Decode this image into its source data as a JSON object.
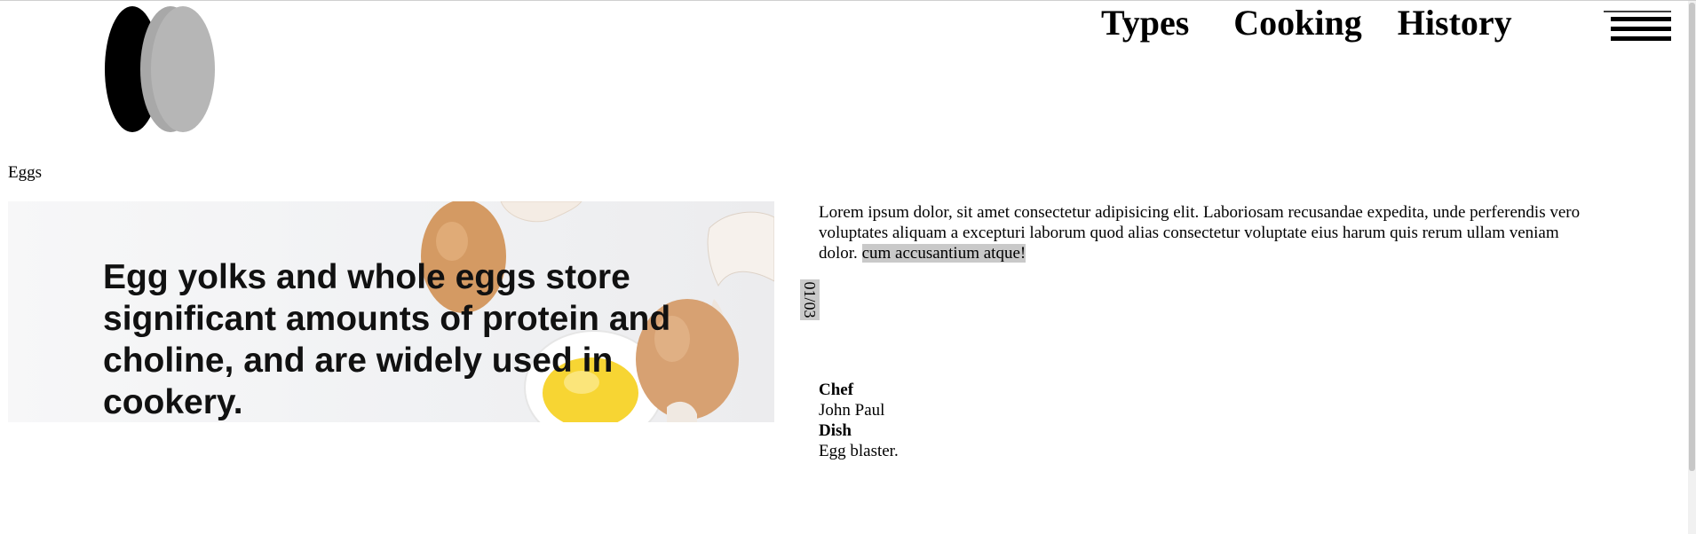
{
  "header": {
    "logo_icon": "egg-pair-logo",
    "nav": [
      {
        "label": "Types"
      },
      {
        "label": "Cooking"
      },
      {
        "label": "History"
      }
    ],
    "menu_icon": "hamburger-menu-icon"
  },
  "breadcrumb": "Eggs",
  "hero": {
    "caption": "Egg yolks and whole eggs store significant amounts of protein and choline, and are widely used in cookery."
  },
  "article": {
    "body": "Lorem ipsum dolor, sit amet consectetur adipisicing elit. Laboriosam recusandae expedita, unde perferendis vero voluptates aliquam a excepturi laborum quod alias consectetur voluptate eius harum quis rerum ullam veniam dolor. ",
    "highlighted": "cum accusantium atque!"
  },
  "slider": {
    "counter": "01/03"
  },
  "meta": {
    "chef_label": "Chef",
    "chef_value": "John Paul",
    "dish_label": "Dish",
    "dish_value": "Egg blaster."
  },
  "colors": {
    "highlight": "#c9c9c9",
    "text": "#000000",
    "logo_dark": "#000000",
    "logo_light": "#b4b4b4"
  }
}
